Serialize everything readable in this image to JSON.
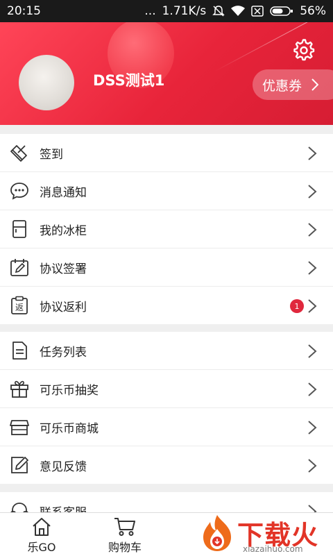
{
  "status": {
    "time": "20:15",
    "dots": "...",
    "speed": "1.71K/s",
    "battery": "56%"
  },
  "profile": {
    "username": "DSS测试1",
    "coupon_label": "优惠券"
  },
  "menu_groups": [
    [
      {
        "label": "签到",
        "icon": "sign-in-icon"
      },
      {
        "label": "消息通知",
        "icon": "message-icon"
      },
      {
        "label": "我的冰柜",
        "icon": "fridge-icon"
      },
      {
        "label": "协议签署",
        "icon": "calendar-sign-icon"
      },
      {
        "label": "协议返利",
        "icon": "rebate-icon",
        "badge": "1"
      }
    ],
    [
      {
        "label": "任务列表",
        "icon": "task-list-icon"
      },
      {
        "label": "可乐币抽奖",
        "icon": "gift-icon"
      },
      {
        "label": "可乐币商城",
        "icon": "store-icon"
      },
      {
        "label": "意见反馈",
        "icon": "feedback-icon"
      }
    ],
    [
      {
        "label": "联系客服",
        "icon": "headset-icon"
      }
    ]
  ],
  "tabs": [
    {
      "label": "乐GO",
      "icon": "home-icon"
    },
    {
      "label": "购物车",
      "icon": "cart-icon"
    }
  ],
  "watermark": {
    "brand": "下载火",
    "url": "xiazaihuo.com"
  },
  "colors": {
    "accent": "#e8243a",
    "badge": "#e0283d"
  }
}
